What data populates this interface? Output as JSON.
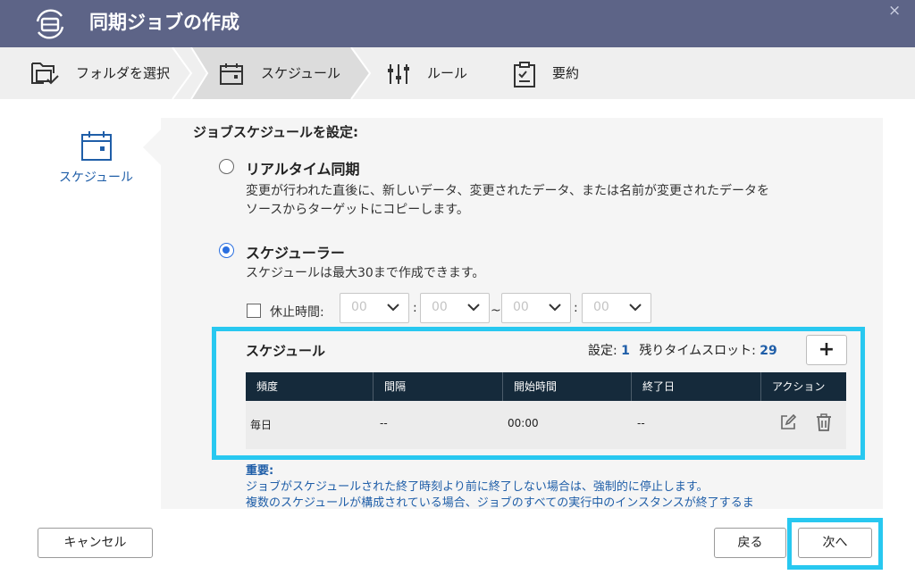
{
  "window": {
    "title": "同期ジョブの作成",
    "close_glyph": "×",
    "title_bar_color": "#5d6487"
  },
  "steps": [
    {
      "label": "フォルダを選択",
      "icon": "folder-select-icon"
    },
    {
      "label": "スケジュール",
      "icon": "calendar-icon",
      "active": true
    },
    {
      "label": "ルール",
      "icon": "sliders-icon"
    },
    {
      "label": "要約",
      "icon": "clipboard-icon"
    }
  ],
  "nav": {
    "label": "スケジュール",
    "icon": "calendar-icon"
  },
  "content": {
    "heading": "ジョブスケジュールを設定:",
    "realtime": {
      "title": "リアルタイム同期",
      "desc_line1": "変更が行われた直後に、新しいデータ、変更されたデータ、または名前が変更されたデータを",
      "desc_line2": "ソースからターゲットにコピーします。",
      "selected": false
    },
    "scheduler": {
      "title": "スケジューラー",
      "desc": "スケジュールは最大30まで作成できます。",
      "selected": true
    },
    "pause": {
      "label": "休止時間:",
      "checked": false,
      "selects": [
        "00",
        "00",
        "00",
        "00"
      ],
      "separators": [
        ":",
        "~",
        ":"
      ]
    },
    "schedule_table": {
      "title": "スケジュール",
      "settings_label": "設定:",
      "settings_count": "1",
      "slots_label": "残りタイムスロット:",
      "slots_count": "29",
      "add_label": "+",
      "columns": [
        "頻度",
        "間隔",
        "開始時間",
        "終了日",
        "アクション"
      ],
      "rows": [
        {
          "frequency": "毎日",
          "interval": "--",
          "start": "00:00",
          "end": "--"
        }
      ]
    },
    "important": {
      "title": "重要:",
      "line1": "ジョブがスケジュールされた終了時刻より前に終了しない場合は、強制的に停止します。",
      "line2": "複数のスケジュールが構成されている場合、ジョブのすべての実行中のインスタンスが終了するま"
    }
  },
  "footer": {
    "cancel": "キャンセル",
    "back": "戻る",
    "next": "次へ"
  },
  "colors": {
    "accent": "#1f5ea8",
    "highlight": "#28c8f0",
    "table_header": "#152a3b"
  }
}
